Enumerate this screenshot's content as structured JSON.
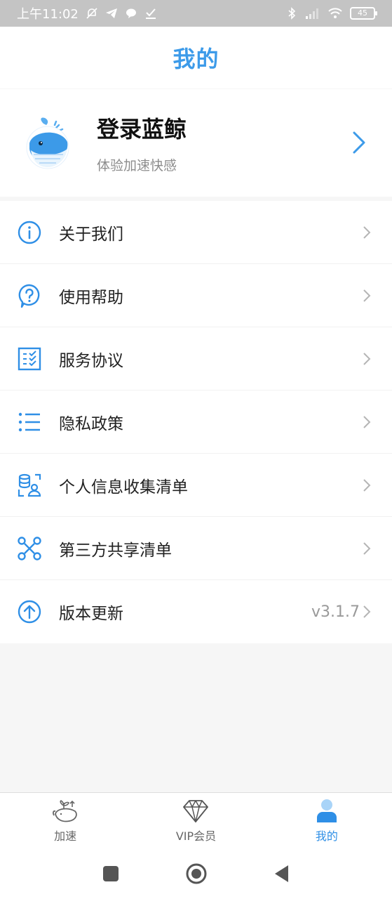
{
  "status_bar": {
    "time": "上午11:02",
    "battery": "45"
  },
  "header": {
    "title": "我的"
  },
  "profile": {
    "name": "登录蓝鲸",
    "subtitle": "体验加速快感",
    "avatar_icon": "whale-avatar-icon"
  },
  "menu": {
    "items": [
      {
        "label": "关于我们",
        "icon": "info-icon"
      },
      {
        "label": "使用帮助",
        "icon": "help-question-icon"
      },
      {
        "label": "服务协议",
        "icon": "checklist-document-icon"
      },
      {
        "label": "隐私政策",
        "icon": "list-icon"
      },
      {
        "label": "个人信息收集清单",
        "icon": "personal-data-icon"
      },
      {
        "label": "第三方共享清单",
        "icon": "share-network-icon"
      },
      {
        "label": "版本更新",
        "icon": "upload-circle-icon",
        "value": "v3.1.7"
      }
    ]
  },
  "bottom_nav": {
    "items": [
      {
        "label": "加速",
        "icon": "whale-plant-icon"
      },
      {
        "label": "VIP会员",
        "icon": "diamond-icon"
      },
      {
        "label": "我的",
        "icon": "user-icon",
        "active": true
      }
    ]
  },
  "colors": {
    "accent": "#3d9be9",
    "status_bar": "#c4c4c4",
    "background": "#f6f6f6"
  }
}
